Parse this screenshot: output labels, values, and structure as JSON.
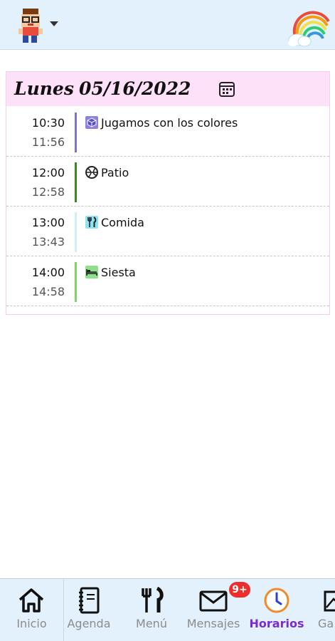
{
  "header": {
    "avatar_icon": "boy-avatar-icon",
    "menu_icon": "caret-down-icon",
    "logo_icon": "rainbow-cloud-icon"
  },
  "schedule": {
    "day": "Lunes",
    "date": "05/16/2022",
    "calendar_icon": "calendar-icon",
    "slots": [
      {
        "start": "10:30",
        "end": "11:56",
        "label": "Jugamos con los colores",
        "icon": "cube-icon",
        "color": "#7a72dc"
      },
      {
        "start": "12:00",
        "end": "12:58",
        "label": "Patio",
        "icon": "ball-icon",
        "color": "#3a8a1e"
      },
      {
        "start": "13:00",
        "end": "13:43",
        "label": "Comida",
        "icon": "cutlery-icon",
        "color": "#cfefff"
      },
      {
        "start": "14:00",
        "end": "14:58",
        "label": "Siesta",
        "icon": "bed-icon",
        "color": "#7bd66a"
      }
    ]
  },
  "bottom_nav": {
    "items": [
      {
        "label": "Inicio",
        "icon": "home-icon"
      },
      {
        "label": "Agenda",
        "icon": "notebook-icon"
      },
      {
        "label": "Menú",
        "icon": "cutlery-icon"
      },
      {
        "label": "Mensajes",
        "icon": "envelope-icon",
        "badge": "9+"
      },
      {
        "label": "Horarios",
        "icon": "clock-icon",
        "active": true
      },
      {
        "label": "Ga",
        "icon": "gallery-icon"
      }
    ],
    "active_color": "#7a2bd6"
  }
}
